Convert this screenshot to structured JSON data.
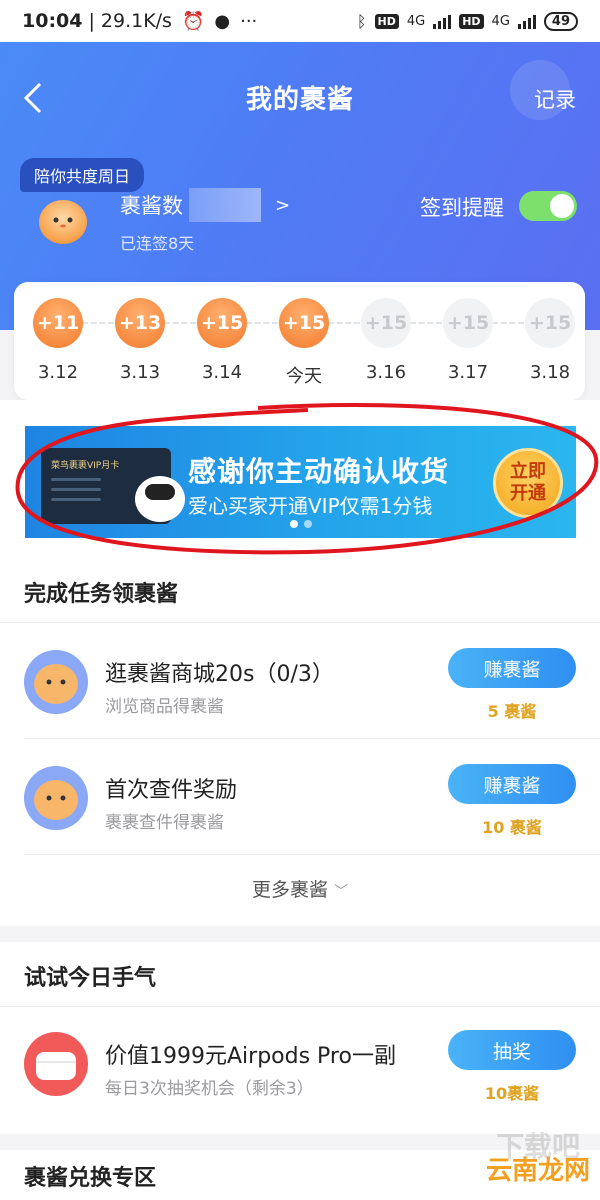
{
  "statusbar": {
    "time": "10:04",
    "speed": "29.1K/s",
    "hd1": "HD",
    "net1": "4G",
    "hd2": "HD",
    "net2": "4G",
    "battery": "49"
  },
  "nav": {
    "title": "我的裹酱",
    "record": "记录"
  },
  "profile": {
    "tag": "陪你共度周日",
    "count_label": "裹酱数",
    "streak": "已连签8天",
    "remind_label": "签到提醒",
    "remind_on": true
  },
  "signin": {
    "days": [
      {
        "points": "+11",
        "date": "3.12",
        "done": true
      },
      {
        "points": "+13",
        "date": "3.13",
        "done": true
      },
      {
        "points": "+15",
        "date": "3.14",
        "done": true
      },
      {
        "points": "+15",
        "date": "今天",
        "done": true
      },
      {
        "points": "+15",
        "date": "3.16",
        "done": false
      },
      {
        "points": "+15",
        "date": "3.17",
        "done": false
      },
      {
        "points": "+15",
        "date": "3.18",
        "done": false
      }
    ]
  },
  "banner": {
    "card_text": "菜鸟裹裹VIP月卡",
    "headline": "感谢你主动确认收货",
    "subline": "爱心买家开通VIP仅需1分钱",
    "cta": "立即开通",
    "accent": "#2196e8"
  },
  "tasks": {
    "title": "完成任务领裹酱",
    "items": [
      {
        "name": "逛裹酱商城20s（0/3）",
        "sub": "浏览商品得裹酱",
        "button": "赚裹酱",
        "reward": "5 裹酱"
      },
      {
        "name": "首次查件奖励",
        "sub": "裹裹查件得裹酱",
        "button": "赚裹酱",
        "reward": "10 裹酱"
      }
    ],
    "more": "更多裹酱"
  },
  "lucky": {
    "title": "试试今日手气",
    "item": {
      "name": "价值1999元Airpods Pro一副",
      "sub": "每日3次抽奖机会（剩余3）",
      "button": "抽奖",
      "reward": "10裹酱"
    }
  },
  "exchange": {
    "title": "裹酱兑换专区"
  },
  "watermark": "云南龙网"
}
